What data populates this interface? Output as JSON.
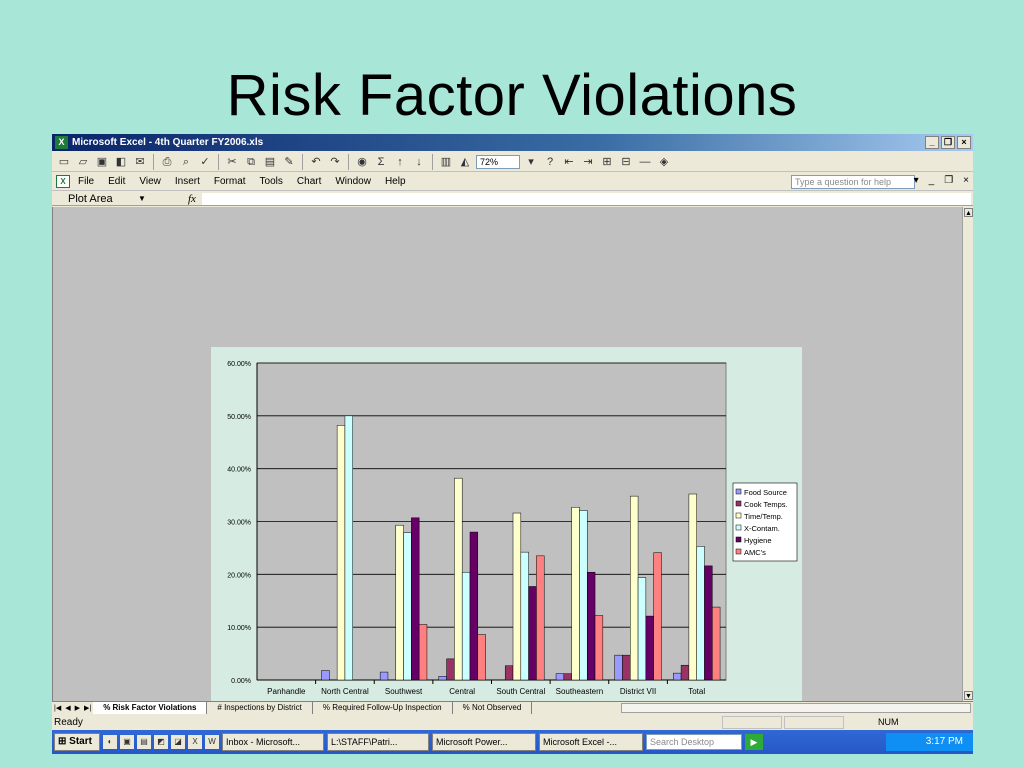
{
  "slide": {
    "title": "Risk Factor Violations"
  },
  "excel": {
    "window_title": "Microsoft Excel - 4th Quarter FY2006.xls",
    "menu": [
      "File",
      "Edit",
      "View",
      "Insert",
      "Format",
      "Tools",
      "Chart",
      "Window",
      "Help"
    ],
    "help_placeholder": "Type a question for help",
    "zoom": "72%",
    "name_box": "Plot Area",
    "fx": "fx",
    "status": "Ready",
    "num_indicator": "NUM",
    "sheet_tabs": [
      "% Risk Factor Violations",
      "# Inspections by District",
      "% Required Follow-Up Inspection",
      "% Not Observed"
    ],
    "active_tab": 0
  },
  "taskbar": {
    "start": "Start",
    "tasks": [
      "Inbox - Microsoft...",
      "L:\\STAFF\\Patri...",
      "Microsoft Power...",
      "Microsoft Excel -..."
    ],
    "search_placeholder": "Search Desktop",
    "time": "3:17 PM"
  },
  "chart_data": {
    "type": "bar",
    "categories": [
      "Panhandle",
      "North Central",
      "Southwest",
      "Central",
      "South Central",
      "Southeastern",
      "District VII",
      "Total"
    ],
    "y_ticks": [
      "0.00%",
      "10.00%",
      "20.00%",
      "30.00%",
      "40.00%",
      "50.00%",
      "60.00%"
    ],
    "ylim": [
      0,
      60
    ],
    "grid": true,
    "legend_position": "right",
    "series": [
      {
        "name": "Food Source",
        "color": "#9999ff",
        "values": [
          0,
          1.8,
          1.5,
          0.7,
          0,
          1.2,
          4.7,
          1.3
        ]
      },
      {
        "name": "Cook Temps.",
        "color": "#993366",
        "values": [
          0,
          0,
          0,
          4.0,
          2.7,
          1.2,
          4.7,
          2.8
        ]
      },
      {
        "name": "Time/Temp.",
        "color": "#ffffcc",
        "values": [
          0,
          48.2,
          29.3,
          38.2,
          31.6,
          32.7,
          34.8,
          35.2
        ]
      },
      {
        "name": "X-Contam.",
        "color": "#ccffff",
        "values": [
          0,
          50.0,
          27.9,
          20.4,
          24.2,
          32.1,
          19.4,
          25.3
        ]
      },
      {
        "name": "Hygiene",
        "color": "#660066",
        "values": [
          0,
          0,
          30.7,
          28.0,
          17.7,
          20.4,
          12.1,
          21.6
        ]
      },
      {
        "name": "AMC's",
        "color": "#ff8080",
        "values": [
          0,
          0,
          10.5,
          8.6,
          23.5,
          12.2,
          24.1,
          13.8
        ]
      }
    ]
  }
}
